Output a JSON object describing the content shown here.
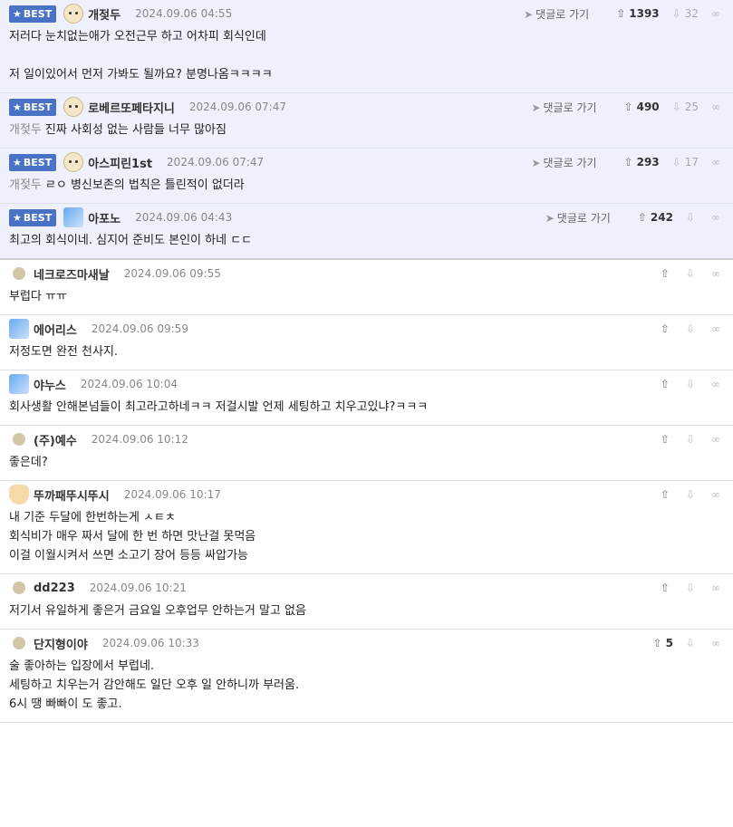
{
  "labels": {
    "best": "BEST",
    "goto": "댓글로 가기"
  },
  "colors": {
    "best_bg": "#eef1fb",
    "badge": "#4a72c4"
  },
  "comments": [
    {
      "best": true,
      "avatar": "dog",
      "nick": "개젖두",
      "date": "2024.09.06 04:55",
      "goto": true,
      "up": "1393",
      "down": "32",
      "ref": "",
      "lines": [
        "저러다 눈치없는애가 오전근무 하고 어차피 회식인데",
        "",
        "저 일이있어서 먼저 가봐도 될까요? 분명나옴ㅋㅋㅋㅋ"
      ]
    },
    {
      "best": true,
      "avatar": "dog",
      "nick": "로베르또페타지니",
      "date": "2024.09.06 07:47",
      "goto": true,
      "up": "490",
      "down": "25",
      "ref": "개젖두",
      "lines": [
        "진짜 사회성 없는 사람들 너무 많아짐"
      ]
    },
    {
      "best": true,
      "avatar": "dog",
      "nick": "아스피린1st",
      "date": "2024.09.06 07:47",
      "goto": true,
      "up": "293",
      "down": "17",
      "ref": "개젖두",
      "lines": [
        "ㄹㅇ 병신보존의 법칙은 틀린적이 없더라"
      ]
    },
    {
      "best": true,
      "avatar": "blue",
      "nick": "아포노",
      "date": "2024.09.06 04:43",
      "goto": true,
      "up": "242",
      "down": "",
      "ref": "",
      "lines": [
        "최고의 회식이네. 심지어 준비도 본인이 하네 ㄷㄷ"
      ]
    },
    {
      "best": false,
      "avatar": "dot",
      "nick": "네크로즈마새날",
      "date": "2024.09.06 09:55",
      "goto": false,
      "up": "",
      "down": "",
      "ref": "",
      "lines": [
        "부럽다 ㅠㅠ"
      ]
    },
    {
      "best": false,
      "avatar": "blue",
      "nick": "에어리스",
      "date": "2024.09.06 09:59",
      "goto": false,
      "up": "",
      "down": "",
      "ref": "",
      "lines": [
        "저정도면 완전 천사지."
      ]
    },
    {
      "best": false,
      "avatar": "blue",
      "nick": "야누스",
      "date": "2024.09.06 10:04",
      "goto": false,
      "up": "",
      "down": "",
      "ref": "",
      "lines": [
        "회사생활 안해본넘들이 최고라고하네ㅋㅋ 저걸시발 언제 세팅하고 치우고있냐?ㅋㅋㅋ"
      ]
    },
    {
      "best": false,
      "avatar": "dot",
      "nick": "(주)예수",
      "date": "2024.09.06 10:12",
      "goto": false,
      "up": "",
      "down": "",
      "ref": "",
      "lines": [
        "좋은데?"
      ]
    },
    {
      "best": false,
      "avatar": "fox",
      "nick": "뚜까패뚜시뚜시",
      "date": "2024.09.06 10:17",
      "goto": false,
      "up": "",
      "down": "",
      "ref": "",
      "lines": [
        "내 기준 두달에 한번하는게 ㅅㅌㅊ",
        "회식비가 매우 짜서 달에 한 번 하면 맛난걸 못먹음",
        "이걸 이월시켜서 쓰면 소고기 장어 등등 싸압가능"
      ]
    },
    {
      "best": false,
      "avatar": "dot",
      "nick": "dd223",
      "date": "2024.09.06 10:21",
      "goto": false,
      "up": "",
      "down": "",
      "ref": "",
      "lines": [
        "저기서 유일하게 좋은거 금요일 오후업무 안하는거 말고 없음"
      ]
    },
    {
      "best": false,
      "avatar": "dot",
      "nick": "단지형이야",
      "date": "2024.09.06 10:33",
      "goto": false,
      "up": "5",
      "down": "",
      "ref": "",
      "lines": [
        "술 좋아하는 입장에서 부럽네.",
        "세팅하고 치우는거 감안해도 일단 오후 일 안하니까 부러움.",
        "6시 땡 빠빠이 도 좋고."
      ]
    }
  ]
}
